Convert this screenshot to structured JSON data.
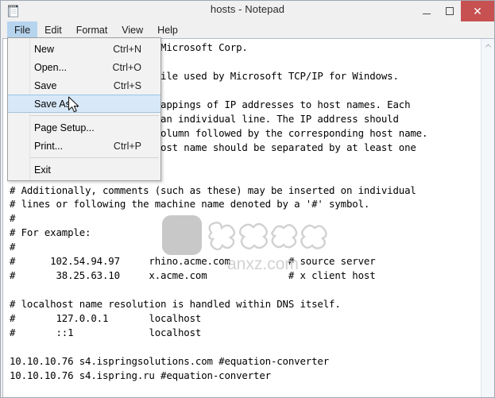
{
  "window": {
    "title": "hosts - Notepad",
    "icon": "notepad-icon",
    "controls": {
      "minimize": "minimize-icon",
      "maximize": "maximize-icon",
      "close": "close-icon",
      "close_glyph": "✕",
      "close_color": "#c75050"
    }
  },
  "menubar": {
    "items": [
      {
        "label": "File",
        "active": true
      },
      {
        "label": "Edit",
        "active": false
      },
      {
        "label": "Format",
        "active": false
      },
      {
        "label": "View",
        "active": false
      },
      {
        "label": "Help",
        "active": false
      }
    ]
  },
  "file_menu": {
    "open": true,
    "items": [
      {
        "label": "New",
        "shortcut": "Ctrl+N",
        "highlight": false,
        "separator_before": false
      },
      {
        "label": "Open...",
        "shortcut": "Ctrl+O",
        "highlight": false,
        "separator_before": false
      },
      {
        "label": "Save",
        "shortcut": "Ctrl+S",
        "highlight": false,
        "separator_before": false
      },
      {
        "label": "Save As...",
        "shortcut": "",
        "highlight": true,
        "separator_before": false
      },
      {
        "label": "Page Setup...",
        "shortcut": "",
        "highlight": false,
        "separator_before": true
      },
      {
        "label": "Print...",
        "shortcut": "Ctrl+P",
        "highlight": false,
        "separator_before": false
      },
      {
        "label": "Exit",
        "shortcut": "",
        "highlight": false,
        "separator_before": true
      }
    ]
  },
  "document": {
    "filename": "hosts",
    "text": "# Copyright (c) 1993-2009 Microsoft Corp.\n#\n# This is a sample HOSTS file used by Microsoft TCP/IP for Windows.\n#\n# This file contains the mappings of IP addresses to host names. Each\n# entry should be kept on an individual line. The IP address should\n# be placed in the first column followed by the corresponding host name.\n# The IP address and the host name should be separated by at least one\n# space.\n#\n# Additionally, comments (such as these) may be inserted on individual\n# lines or following the machine name denoted by a '#' symbol.\n#\n# For example:\n#\n#      102.54.94.97     rhino.acme.com          # source server\n#       38.25.63.10     x.acme.com              # x client host\n\n# localhost name resolution is handled within DNS itself.\n#\t127.0.0.1       localhost\n#\t::1             localhost\n\n10.10.10.76 s4.ispringsolutions.com #equation-converter\n10.10.10.76 s4.ispring.ru #equation-converter\n"
  },
  "scrollbar": {
    "up_arrow": "chevron-up-icon"
  },
  "watermark": {
    "text": "anxz.com",
    "logo": "shield-bag-logo"
  },
  "cursor": {
    "type": "arrow-pointer"
  }
}
